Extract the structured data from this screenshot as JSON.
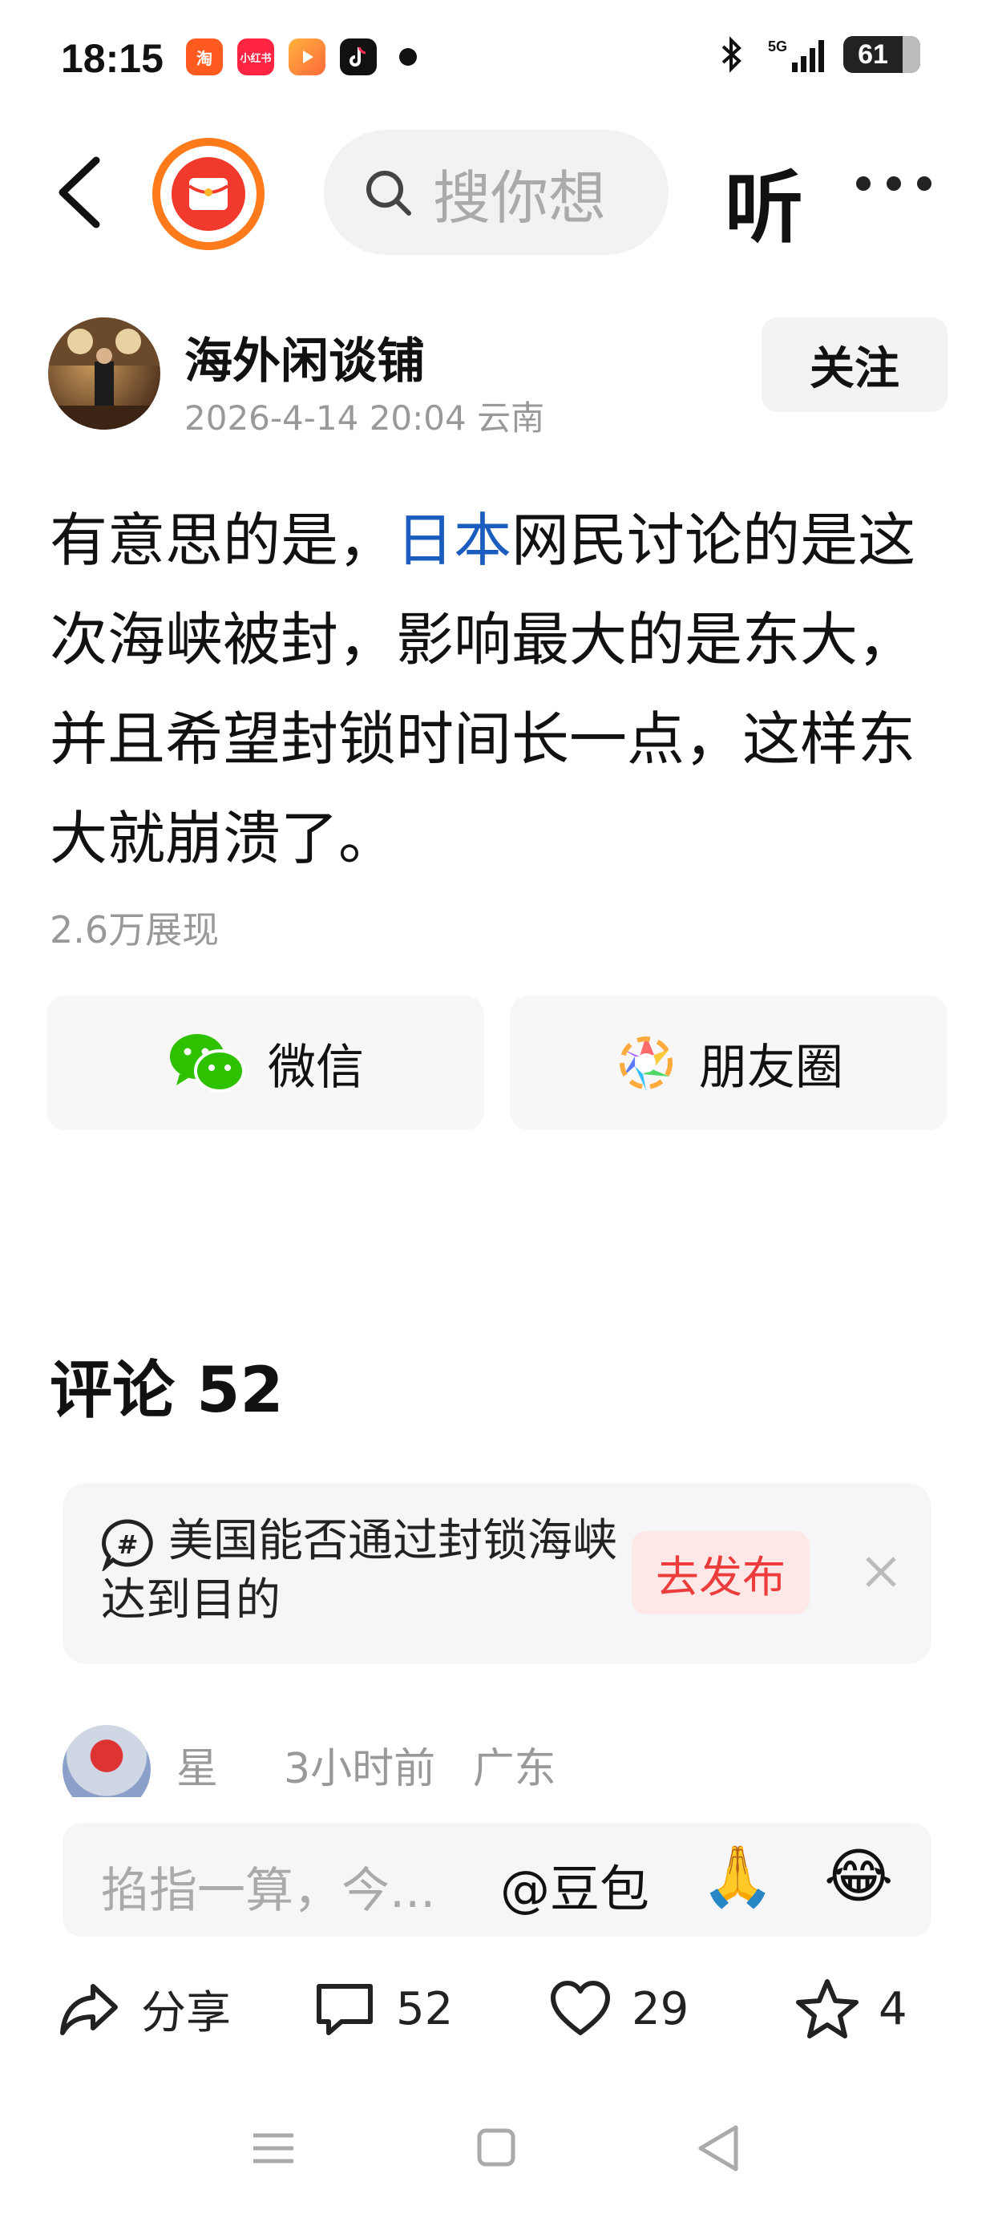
{
  "status_bar": {
    "time": "18:15",
    "app_icons": [
      {
        "name": "taobao-icon",
        "label": "淘",
        "color": "#ff5a1f"
      },
      {
        "name": "xiaohongshu-icon",
        "label": "小红书",
        "color": "#ff2442"
      },
      {
        "name": "video-app-icon",
        "label": "",
        "color": "#ff9a2f"
      },
      {
        "name": "tiktok-icon",
        "label": "",
        "color": "#111111"
      }
    ],
    "network": "5G",
    "battery": "61"
  },
  "top_nav": {
    "search_placeholder": "搜你想",
    "listen_label": "听"
  },
  "author": {
    "name": "海外闲谈铺",
    "date": "2026-4-14 20:04",
    "location": "云南",
    "follow_label": "关注"
  },
  "post": {
    "text_before_link": "有意思的是，",
    "link_text": "日本",
    "text_after_link": "网民讨论的是这次海峡被封，影响最大的是东大，并且希望封锁时间长一点，这样东大就崩溃了。",
    "views": "2.6万展现"
  },
  "share": {
    "wechat_label": "微信",
    "moments_label": "朋友圈"
  },
  "comments": {
    "title": "评论 52",
    "topic": {
      "text": "美国能否通过封锁海峡达到目的",
      "publish_label": "去发布"
    },
    "first_comment": {
      "name": "星",
      "time": "3小时前",
      "location": "广东"
    }
  },
  "input_bar": {
    "placeholder": "掐指一算，今...",
    "mention": "@豆包",
    "emojis": [
      "🙏",
      "😂"
    ]
  },
  "actions": {
    "share_label": "分享",
    "comment_count": "52",
    "like_count": "29",
    "favorite_count": "4"
  },
  "colors": {
    "link": "#1a5dbf",
    "accent_red": "#ec3c3c",
    "wechat_green": "#2dc100"
  }
}
